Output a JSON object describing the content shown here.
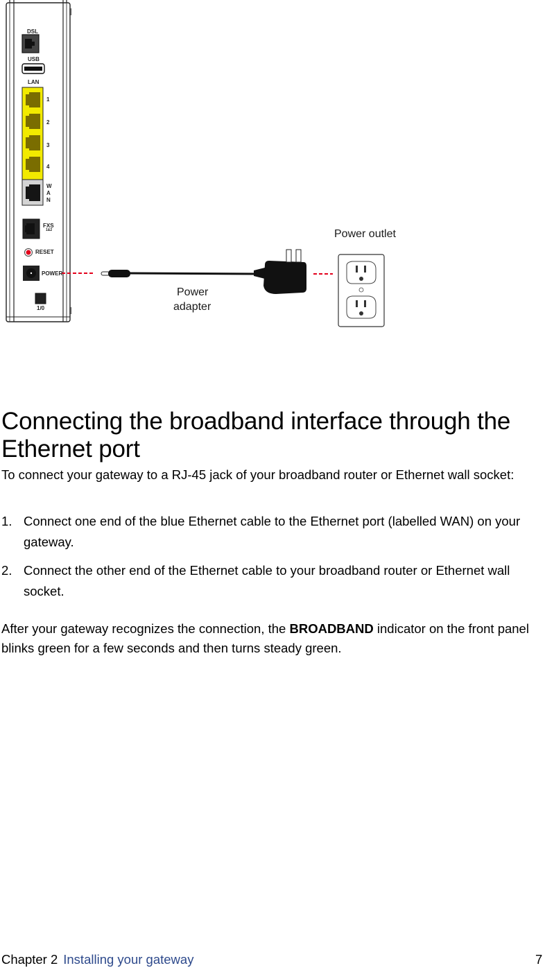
{
  "diagram": {
    "device_labels": {
      "dsl": "DSL",
      "usb": "USB",
      "lan": "LAN",
      "lan_ports": [
        "1",
        "2",
        "3",
        "4"
      ],
      "wan": [
        "W",
        "A",
        "N"
      ],
      "fxs": "FXS",
      "fxs_sub": "1&2",
      "reset": "RESET",
      "power": "POWER",
      "io": "1/0"
    },
    "power_adapter_label_line1": "Power",
    "power_adapter_label_line2": "adapter",
    "power_outlet_label": "Power outlet",
    "colors": {
      "lan_port_bg": "#f2ea00",
      "lan_port_jack": "#7a6d00",
      "wan_port_bg": "#d4d4d4",
      "reset_dot": "#e3001b",
      "dashed_line": "#e3001b"
    }
  },
  "section": {
    "title": "Connecting the broadband interface through the Ethernet port",
    "intro": "To connect your gateway to a RJ-45 jack of your broadband router or Ethernet wall socket:",
    "steps": [
      {
        "number": "1.",
        "text": "Connect one end of the blue Ethernet cable to the Ethernet port (labelled WAN) on your gateway."
      },
      {
        "number": "2.",
        "text": "Connect the other end of the Ethernet cable to your broadband router or Ethernet wall socket."
      }
    ],
    "after_prefix": "After your gateway recognizes the connection, the ",
    "after_bold": "BROADBAND",
    "after_suffix": " indicator on the front panel blinks green for a few seconds and then turns steady green."
  },
  "footer": {
    "chapter": "Chapter 2",
    "chapter_title": "Installing your gateway",
    "page_number": "7",
    "chapter_title_color": "#2e4a8c"
  }
}
